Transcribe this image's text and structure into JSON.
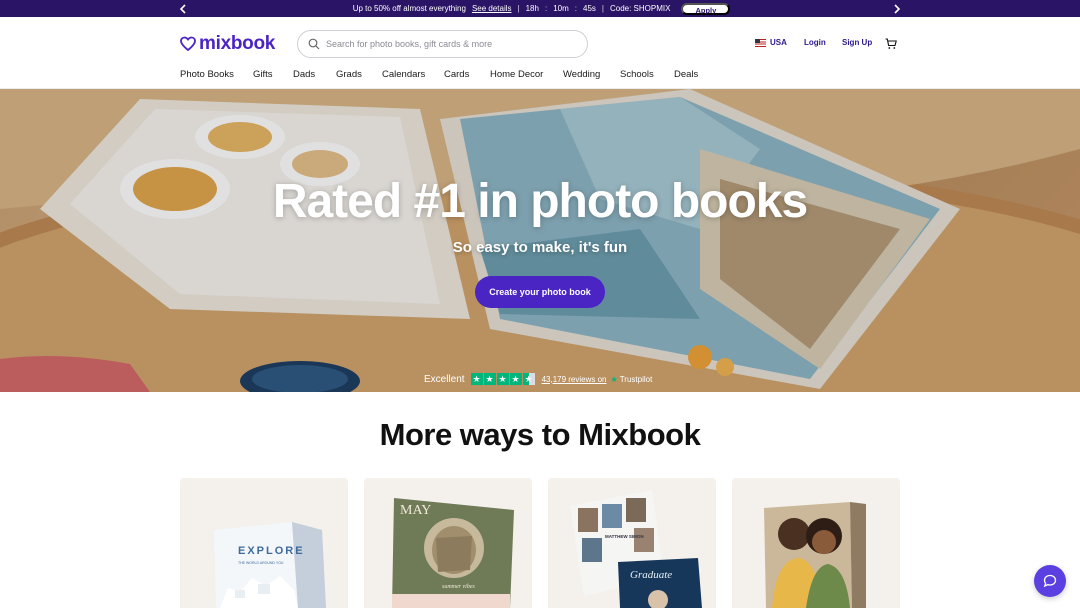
{
  "promo": {
    "text": "Up to 50% off almost everything",
    "details_link": "See details",
    "timer": {
      "hours": "18h",
      "minutes": "10m",
      "seconds": "45s"
    },
    "code": "Code: SHOPMIX",
    "apply_label": "Apply"
  },
  "header": {
    "logo_text": "mixbook",
    "search_placeholder": "Search for photo books, gift cards & more",
    "country": "USA",
    "login_label": "Login",
    "signup_label": "Sign Up"
  },
  "nav": {
    "items": [
      "Photo Books",
      "Gifts",
      "Dads",
      "Grads",
      "Calendars",
      "Cards",
      "Home Decor",
      "Wedding",
      "Schools",
      "Deals"
    ]
  },
  "hero": {
    "title": "Rated #1 in photo books",
    "subtitle": "So easy to make, it's fun",
    "cta_label": "Create your photo book",
    "trustpilot": {
      "rating_label": "Excellent",
      "reviews_text": "43,179 reviews on",
      "brand": "Trustpilot",
      "stars": 4.5
    }
  },
  "more": {
    "title": "More ways to Mixbook",
    "cards": [
      {
        "book_title": "EXPLORE",
        "book_subtitle": "THE WORLD AROUND YOU"
      },
      {
        "calendar_month": "MAY",
        "calendar_caption": "summer vibes"
      },
      {
        "yearbook_name": "MATTHEW SIMON",
        "card_script": "Graduate"
      },
      {
        "type": "canvas"
      }
    ]
  },
  "colors": {
    "brand": "#4a25c4",
    "promo_bg": "#2a1465",
    "trustpilot": "#00b67a",
    "chat": "#5b3fe0"
  }
}
